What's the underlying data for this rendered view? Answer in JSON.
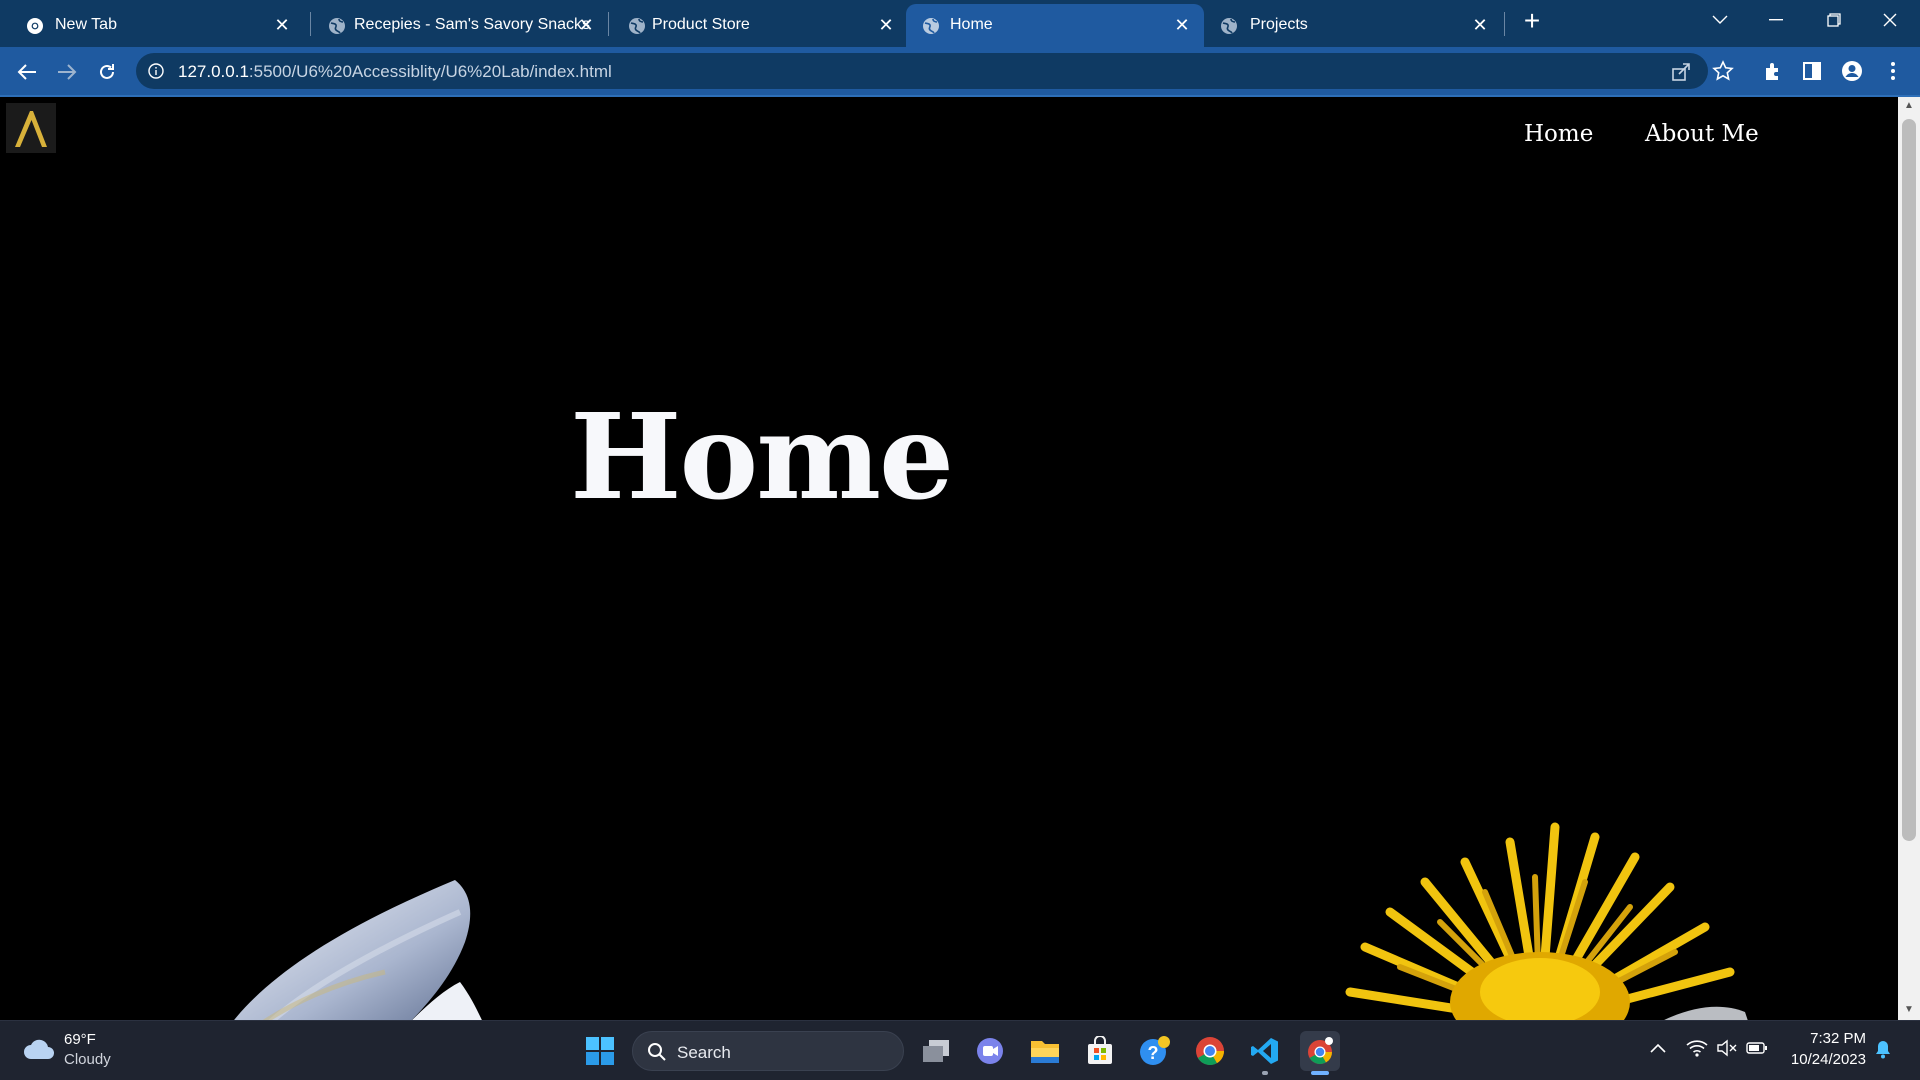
{
  "browser": {
    "tabs": [
      {
        "title": "New Tab",
        "active": false
      },
      {
        "title": "Recepies - Sam's Savory Snacks",
        "active": false
      },
      {
        "title": "Product Store",
        "active": false
      },
      {
        "title": "Home",
        "active": true
      },
      {
        "title": "Projects",
        "active": false
      }
    ],
    "new_tab_label": "+",
    "close_label": "✕",
    "address": {
      "host": "127.0.0.1",
      "path": ":5500/U6%20Accessiblity/U6%20Lab/index.html"
    },
    "colors": {
      "tabstrip": "#0f3a63",
      "toolbar": "#1f5aa0"
    }
  },
  "page": {
    "logo_glyph": "Λ",
    "nav": {
      "home": "Home",
      "about": "About Me"
    },
    "hero_title": "Home",
    "colors": {
      "background": "#000000",
      "logo_gold": "#d8b13a",
      "text": "#ffffff"
    }
  },
  "taskbar": {
    "weather": {
      "temp": "69°F",
      "condition": "Cloudy",
      "icon": "cloud-icon"
    },
    "search_label": "Search",
    "apps": [
      "start-icon",
      "task-view-icon",
      "teams-chat-icon",
      "file-explorer-icon",
      "store-icon",
      "help-icon",
      "chrome-icon",
      "vscode-icon",
      "chrome-canary-icon"
    ],
    "clock": {
      "time": "7:32 PM",
      "date": "10/24/2023"
    }
  }
}
